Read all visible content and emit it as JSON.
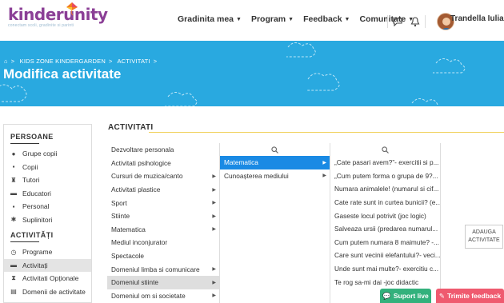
{
  "header": {
    "brand": "kinderunity",
    "tagline": "conectam scoli, gradinite si parinti",
    "nav": [
      "Gradinita mea",
      "Program",
      "Feedback",
      "Comunitate"
    ],
    "user_name": "Trandella Iulia"
  },
  "banner": {
    "breadcrumb": [
      "KIDS ZONE KINDERGARDEN",
      "ACTIVITATI"
    ],
    "title": "Modifica activitate"
  },
  "sidebar": {
    "section1_title": "PERSOANE",
    "section1_items": [
      {
        "label": "Grupe copii",
        "icon": "group-icon"
      },
      {
        "label": "Copii",
        "icon": "child-icon"
      },
      {
        "label": "Tutori",
        "icon": "tutor-icon"
      },
      {
        "label": "Educatori",
        "icon": "educator-icon"
      },
      {
        "label": "Personal",
        "icon": "person-icon"
      },
      {
        "label": "Suplinitori",
        "icon": "substitute-icon"
      }
    ],
    "section2_title": "ACTIVITĂȚI",
    "section2_items": [
      {
        "label": "Programe",
        "icon": "clock-icon"
      },
      {
        "label": "Activitați",
        "icon": "activities-icon"
      },
      {
        "label": "Activitati Opționale",
        "icon": "hourglass-icon"
      },
      {
        "label": "Domenii de activitate",
        "icon": "domain-icon"
      }
    ]
  },
  "main": {
    "title": "ACTIVITATI",
    "col1": [
      {
        "label": "Dezvoltare personala",
        "arrow": false
      },
      {
        "label": "Activitati psihologice",
        "arrow": false
      },
      {
        "label": "Cursuri de muzica/canto",
        "arrow": true
      },
      {
        "label": "Activitati plastice",
        "arrow": true
      },
      {
        "label": "Sport",
        "arrow": true
      },
      {
        "label": "Stiinte",
        "arrow": true
      },
      {
        "label": "Matematica",
        "arrow": true
      },
      {
        "label": "Mediul inconjurator",
        "arrow": false
      },
      {
        "label": "Spectacole",
        "arrow": false
      },
      {
        "label": "Domeniul limba si comunicare",
        "arrow": true
      },
      {
        "label": "Domeniul stiinte",
        "arrow": true
      },
      {
        "label": "Domeniul om si societate",
        "arrow": true
      }
    ],
    "col2": [
      {
        "label": "Matematica",
        "arrow": true
      },
      {
        "label": "Cunoașterea mediului",
        "arrow": true
      }
    ],
    "col3": [
      "„Cate pasari avem?”- exercitii si p...",
      "„Cum putem forma o grupa de 9?...",
      "Numara animalele! (numarul si cif...",
      "Cate rate sunt in curtea bunicii? (e...",
      "Gaseste locul potrivit (joc logic)",
      "Salveaza ursii (predarea numarul...",
      "Cum putem numara 8 maimute? -...",
      "Care sunt vecinii elefantului?- veci...",
      "Unde sunt mai multe?- exercitiu c...",
      "Te rog sa-mi dai -joc didactic"
    ],
    "add_button": [
      "ADAUGA",
      "ACTIVITATE"
    ]
  },
  "footer": {
    "support": "Suport live",
    "feedback": "Trimite feedback"
  },
  "colors": {
    "banner": "#29a9e0",
    "brand": "#8b3f96",
    "selected": "#1a8ae4",
    "support": "#33b17c",
    "feedback": "#ef5a6f"
  }
}
